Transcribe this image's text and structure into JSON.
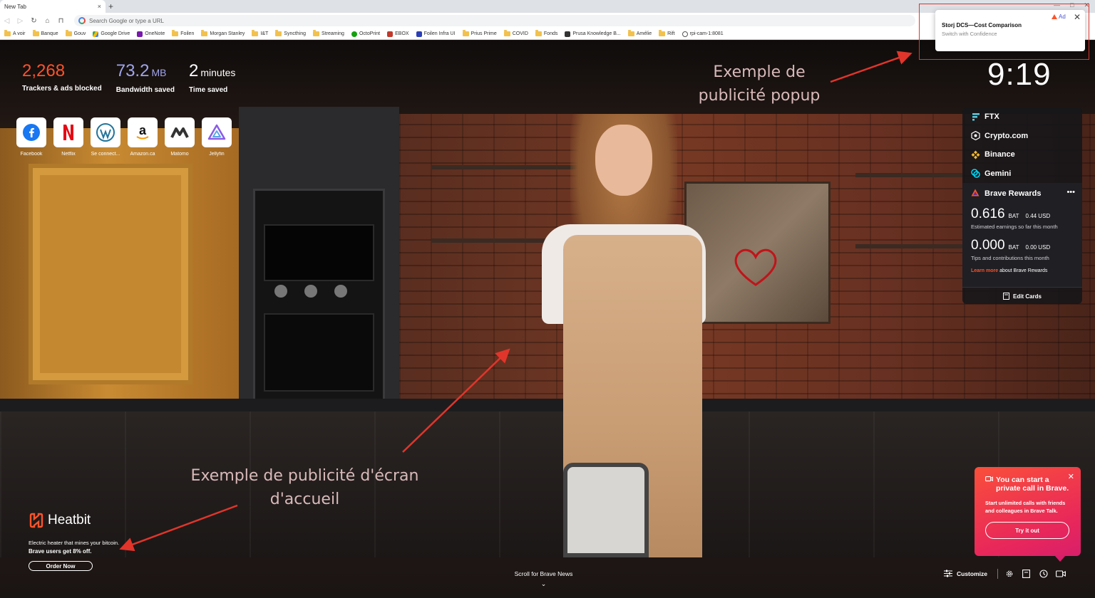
{
  "browser": {
    "tab_title": "New Tab",
    "tab_close": "×",
    "new_tab": "+",
    "omnibox_placeholder": "Search Google or type a URL",
    "bookmarks": [
      {
        "label": "A voir",
        "icon": "folder-icon"
      },
      {
        "label": "Banque",
        "icon": "folder-icon"
      },
      {
        "label": "Gouv",
        "icon": "folder-icon"
      },
      {
        "label": "Google Drive",
        "icon": "google-drive-icon"
      },
      {
        "label": "OneNote",
        "icon": "onenote-icon"
      },
      {
        "label": "Foilen",
        "icon": "folder-icon"
      },
      {
        "label": "Morgan Stanley",
        "icon": "folder-icon"
      },
      {
        "label": "I&T",
        "icon": "folder-icon"
      },
      {
        "label": "Syncthing",
        "icon": "folder-icon"
      },
      {
        "label": "Streaming",
        "icon": "folder-icon"
      },
      {
        "label": "OctoPrint",
        "icon": "octoprint-icon"
      },
      {
        "label": "EBOX",
        "icon": "ebox-icon"
      },
      {
        "label": "Foilen Infra UI",
        "icon": "foilen-icon"
      },
      {
        "label": "Prius Prime",
        "icon": "folder-icon"
      },
      {
        "label": "COVID",
        "icon": "folder-icon"
      },
      {
        "label": "Fonds",
        "icon": "folder-icon"
      },
      {
        "label": "Prusa Knowledge B...",
        "icon": "prusa-icon"
      },
      {
        "label": "Amélie",
        "icon": "folder-icon"
      },
      {
        "label": "Rift",
        "icon": "folder-icon"
      },
      {
        "label": "rpi-cam-1:8081",
        "icon": "globe-icon"
      }
    ]
  },
  "stats": {
    "trackers_value": "2,268",
    "trackers_label": "Trackers & ads blocked",
    "bandwidth_value": "73.2",
    "bandwidth_unit": "MB",
    "bandwidth_label": "Bandwidth saved",
    "time_value": "2",
    "time_unit": "minutes",
    "time_label": "Time saved"
  },
  "top_sites": [
    {
      "name": "Facebook",
      "icon": "facebook-icon"
    },
    {
      "name": "Netflix",
      "icon": "netflix-icon"
    },
    {
      "name": "Se connect...",
      "icon": "wordpress-icon"
    },
    {
      "name": "Amazon.ca",
      "icon": "amazon-icon"
    },
    {
      "name": "Matomo",
      "icon": "matomo-icon"
    },
    {
      "name": "Jellyfin",
      "icon": "jellyfin-icon"
    }
  ],
  "clock": "9:19",
  "annotations": {
    "popup": "Exemple de publicité popup",
    "homescreen": "Exemple de publicité d'écran d'accueil"
  },
  "ad_popup": {
    "tag": "Ad",
    "title": "Storj DCS—Cost Comparison",
    "body": "Switch with Confidence",
    "close": "✕"
  },
  "widget": {
    "exchanges": [
      "FTX",
      "Crypto.com",
      "Binance",
      "Gemini"
    ],
    "rewards": {
      "title": "Brave Rewards",
      "menu": "•••",
      "earnings_value": "0.616",
      "earnings_unit": "BAT",
      "earnings_usd": "0.44 USD",
      "earnings_desc": "Estimated earnings so far this month",
      "tips_value": "0.000",
      "tips_unit": "BAT",
      "tips_usd": "0.00 USD",
      "tips_desc": "Tips and contributions this month",
      "learn_link": "Learn more",
      "learn_rest": "about Brave Rewards"
    },
    "edit_cards": "Edit Cards"
  },
  "sponsor": {
    "brand": "Heatbit",
    "desc": "Electric heater that mines your bitcoin.",
    "offer": "Brave users get 8% off.",
    "button": "Order Now"
  },
  "talk_promo": {
    "title": "You can start a private call in Brave.",
    "body": "Start unlimited calls with friends and colleagues in Brave Talk.",
    "button": "Try it out",
    "close": "✕"
  },
  "bottom": {
    "scroll_news": "Scroll for Brave News",
    "customize": "Customize"
  },
  "colors": {
    "brave_orange": "#fb542b",
    "bandwidth_purple": "#a0a5eb",
    "annotation_red": "#e1352b"
  }
}
